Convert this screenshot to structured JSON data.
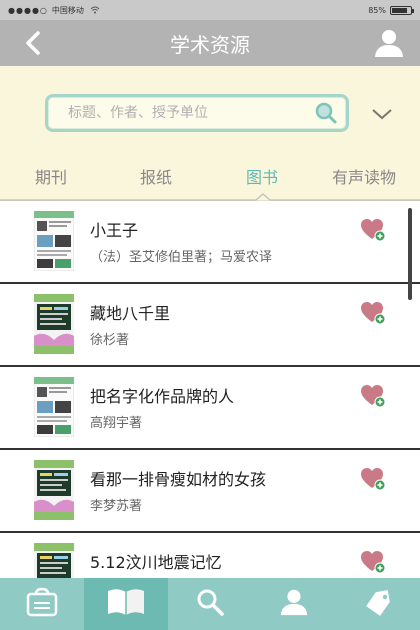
{
  "status_bar": {
    "signal": "●●●●○",
    "carrier": "中国移动",
    "battery_text": "85%",
    "battery_level": 0.85
  },
  "nav": {
    "title": "学术资源",
    "back_icon": "chevron-left-icon",
    "user_icon": "user-icon"
  },
  "search": {
    "placeholder": "标题、作者、授予单位",
    "value": ""
  },
  "tabs": [
    {
      "label": "期刊",
      "active": false
    },
    {
      "label": "报纸",
      "active": false
    },
    {
      "label": "图书",
      "active": true
    },
    {
      "label": "有声读物",
      "active": false
    }
  ],
  "books": [
    {
      "title": "小王子",
      "author": "（法）圣艾修伯里著；马爱农译",
      "cover_style": "white"
    },
    {
      "title": "藏地八千里",
      "author": "徐杉著",
      "cover_style": "dark"
    },
    {
      "title": "把名字化作品牌的人",
      "author": "高翔宇著",
      "cover_style": "white"
    },
    {
      "title": "看那一排骨瘦如材的女孩",
      "author": "李梦苏著",
      "cover_style": "dark"
    },
    {
      "title": "5.12汶川地震记忆",
      "author": "",
      "cover_style": "dark"
    }
  ],
  "bottom_nav": [
    {
      "icon": "bag-icon",
      "active": false
    },
    {
      "icon": "book-icon",
      "active": true
    },
    {
      "icon": "search-icon",
      "active": false
    },
    {
      "icon": "user-icon",
      "active": false
    },
    {
      "icon": "tag-icon",
      "active": false
    }
  ],
  "colors": {
    "accent": "#5fb9b3",
    "bottom_bar": "#8fcac4",
    "nav_bar": "#b3b3b3",
    "search_bg": "#faf6dc",
    "favorite": "#c97a86",
    "favorite_plus": "#3fa05a"
  }
}
